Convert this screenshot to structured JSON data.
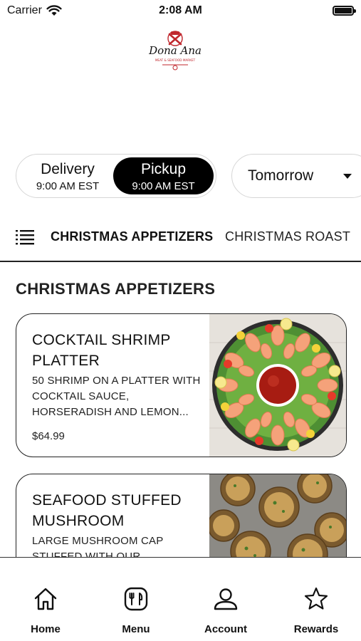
{
  "status_bar": {
    "carrier": "Carrier",
    "time": "2:08 AM"
  },
  "brand": {
    "logo_text": "Dona Ana",
    "logo_subtext": "MEAT & SEAFOOD MARKET"
  },
  "order_mode": {
    "options": [
      {
        "label": "Delivery",
        "time": "9:00 AM EST",
        "selected": false
      },
      {
        "label": "Pickup",
        "time": "9:00 AM EST",
        "selected": true
      }
    ],
    "day": "Tomorrow"
  },
  "categories": {
    "tabs": [
      "CHRISTMAS APPETIZERS",
      "CHRISTMAS ROAST"
    ],
    "active_index": 0
  },
  "section": {
    "title": "CHRISTMAS APPETIZERS"
  },
  "items": [
    {
      "name": "COCKTAIL SHRIMP PLATTER",
      "description": "50 SHRIMP ON A PLATTER WITH COCKTAIL SAUCE, HORSERADISH AND LEMON...",
      "price": "$64.99"
    },
    {
      "name": "SEAFOOD STUFFED MUSHROOM",
      "description": "LARGE MUSHROOM CAP STUFFED WITH OUR",
      "price": ""
    }
  ],
  "bottom_nav": [
    {
      "label": "Home",
      "icon": "home-icon"
    },
    {
      "label": "Menu",
      "icon": "menu-icon"
    },
    {
      "label": "Account",
      "icon": "account-icon"
    },
    {
      "label": "Rewards",
      "icon": "star-icon"
    }
  ],
  "colors": {
    "accent": "#000000",
    "brand_red": "#c0272d",
    "background": "#ffffff"
  }
}
